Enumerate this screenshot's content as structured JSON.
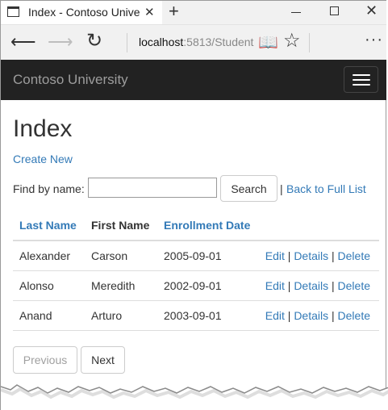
{
  "browser": {
    "tab_title": "Index - Contoso Univers",
    "close_tab": "✕",
    "new_tab": "+",
    "url_host": "localhost",
    "url_rest": ":5813/Student"
  },
  "site": {
    "brand": "Contoso University"
  },
  "page": {
    "title": "Index",
    "create_new": "Create New",
    "find_label": "Find by name:",
    "search_value": "",
    "search_button": "Search",
    "separator": "|",
    "back_to_full_list": "Back to Full List"
  },
  "table": {
    "headers": {
      "last_name": "Last Name",
      "first_name": "First Name",
      "enrollment_date": "Enrollment Date"
    },
    "rows": [
      {
        "last_name": "Alexander",
        "first_name": "Carson",
        "enrollment_date": "2005-09-01"
      },
      {
        "last_name": "Alonso",
        "first_name": "Meredith",
        "enrollment_date": "2002-09-01"
      },
      {
        "last_name": "Anand",
        "first_name": "Arturo",
        "enrollment_date": "2003-09-01"
      }
    ],
    "actions": {
      "edit": "Edit",
      "details": "Details",
      "delete": "Delete",
      "sep": "|"
    }
  },
  "pager": {
    "previous": "Previous",
    "next": "Next"
  },
  "colors": {
    "link": "#337ab7",
    "navbar_bg": "#222222",
    "brand_text": "#9d9d9d"
  }
}
